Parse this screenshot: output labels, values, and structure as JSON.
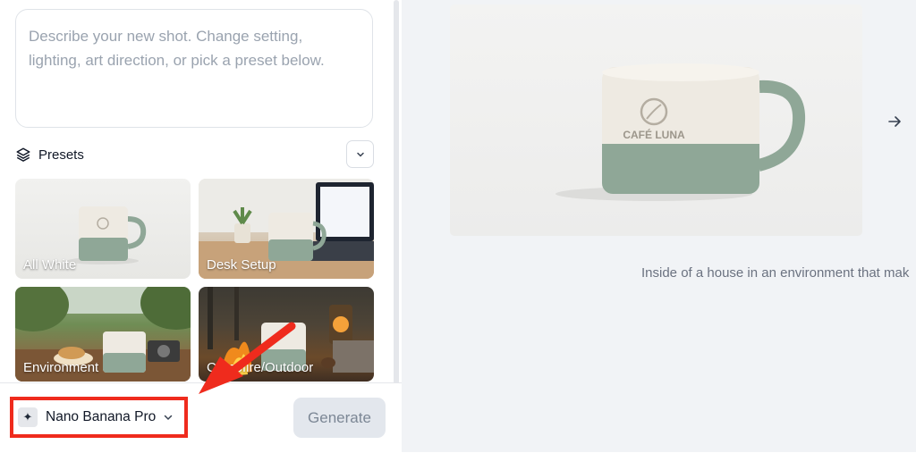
{
  "prompt": {
    "placeholder": "Describe your new shot. Change setting, lighting, art direction, or pick a preset below."
  },
  "presets": {
    "title": "Presets",
    "items": [
      {
        "label": "All White"
      },
      {
        "label": "Desk Setup"
      },
      {
        "label": "Environment"
      },
      {
        "label": "Campfire/Outdoor"
      }
    ]
  },
  "toolbar": {
    "model_name": "Nano Banana Pro",
    "generate_label": "Generate"
  },
  "preview": {
    "mug_text": "CAFÉ LUNA",
    "caption": "Inside of a house in an environment that mak"
  },
  "colors": {
    "highlight": "#ef2b1d",
    "mug_green": "#8fa797",
    "mug_cream": "#eeeae2"
  }
}
